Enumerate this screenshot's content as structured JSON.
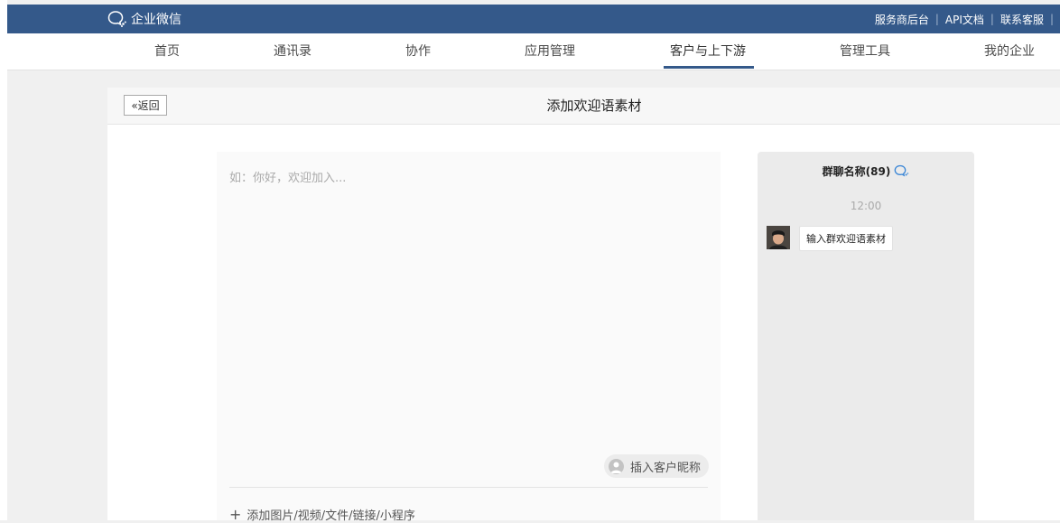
{
  "topbar": {
    "brand": "企业微信",
    "links": [
      "服务商后台",
      "API文档",
      "联系客服"
    ]
  },
  "nav": {
    "items": [
      "首页",
      "通讯录",
      "协作",
      "应用管理",
      "客户与上下游",
      "管理工具",
      "我的企业"
    ],
    "active_index": 4
  },
  "page": {
    "back_label": "返回",
    "title": "添加欢迎语素材"
  },
  "editor": {
    "placeholder": "如：你好，欢迎加入...",
    "insert_nickname_label": "插入客户昵称",
    "add_media_label": "添加图片/视频/文件/链接/小程序"
  },
  "preview": {
    "group_name": "群聊名称(89)",
    "time": "12:00",
    "message": "输入群欢迎语素材"
  },
  "colors": {
    "brand_blue": "#34598a",
    "page_bg": "#f0f0f0",
    "preview_bg": "#ebebeb",
    "chat_icon_blue": "#3a86d6"
  }
}
